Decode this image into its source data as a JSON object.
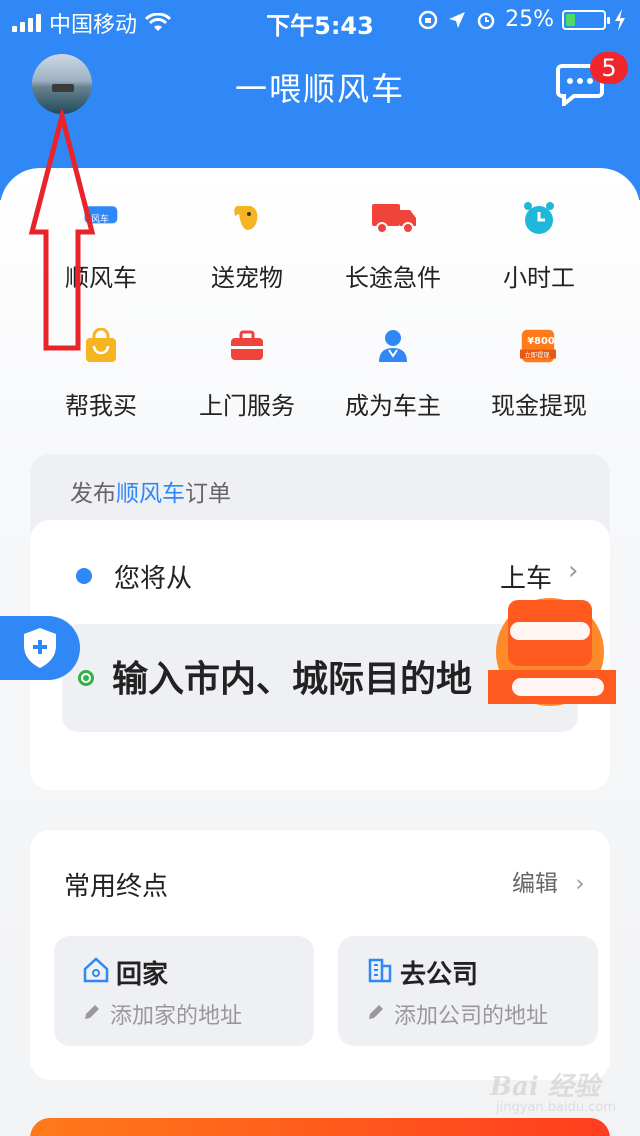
{
  "status_bar": {
    "carrier": "中国移动",
    "time": "下午5:43",
    "battery": "25%",
    "battery_level": 0.25
  },
  "header": {
    "title": "一喂顺风车",
    "message_badge": "5",
    "avatar_icon": "avatar-photo",
    "message_icon": "chat-bubble-icon"
  },
  "services": [
    {
      "label": "顺风车",
      "icon": "car-icon"
    },
    {
      "label": "送宠物",
      "icon": "dog-icon"
    },
    {
      "label": "长途急件",
      "icon": "truck-icon"
    },
    {
      "label": "小时工",
      "icon": "alarm-clock-icon"
    },
    {
      "label": "帮我买",
      "icon": "shopping-bag-icon"
    },
    {
      "label": "上门服务",
      "icon": "toolbox-icon"
    },
    {
      "label": "成为车主",
      "icon": "driver-person-icon"
    },
    {
      "label": "现金提现",
      "icon": "cash-withdraw-icon"
    }
  ],
  "service_icon_text": {
    "car": "风车",
    "cash_amount": "¥800",
    "cash_caption": "立即提现"
  },
  "publish": {
    "title_prefix": "发布",
    "title_highlight": "顺风车",
    "title_suffix": "订单",
    "from_text": "您将从",
    "from_suffix": "上车",
    "destination_placeholder": "输入市内、城际目的地"
  },
  "frequent": {
    "title": "常用终点",
    "edit_label": "编辑",
    "items": [
      {
        "name": "回家",
        "hint": "添加家的地址",
        "icon": "home-icon"
      },
      {
        "name": "去公司",
        "hint": "添加公司的地址",
        "icon": "office-building-icon"
      }
    ]
  },
  "watermark": {
    "text": "Bai 经验",
    "sub": "jingyan.baidu.com"
  },
  "colors": {
    "brand_blue": "#2f88f5",
    "badge_red": "#f0262c",
    "annotation_red": "#e8232a",
    "promo_orange": "#ff5a1f"
  }
}
